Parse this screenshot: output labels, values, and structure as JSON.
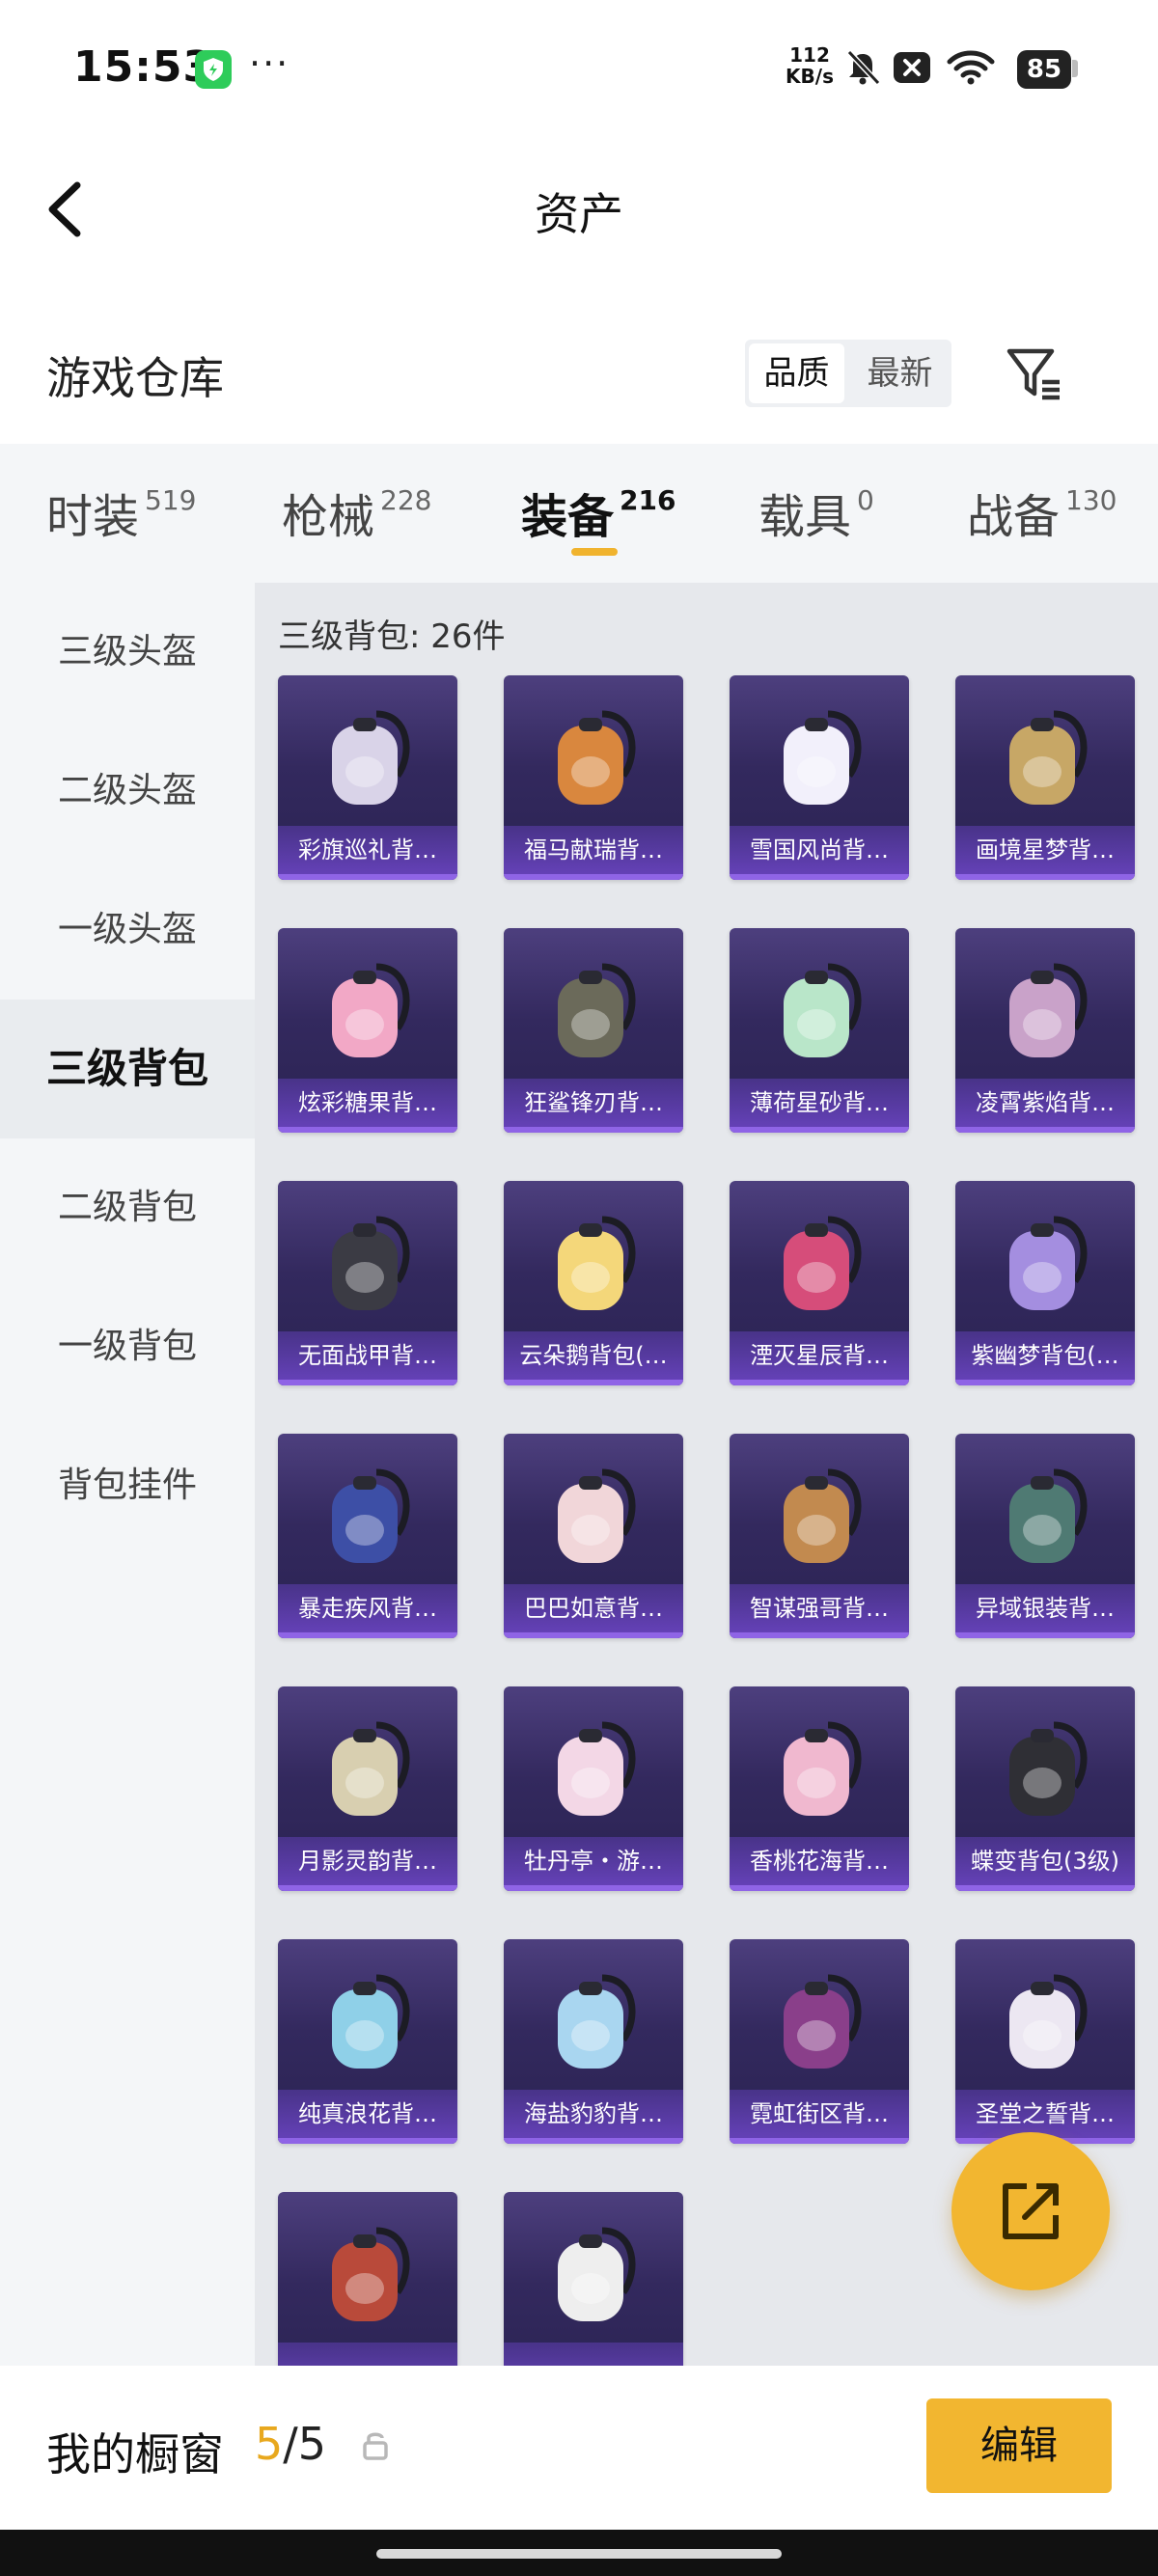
{
  "status_bar": {
    "time": "15:53",
    "speed_value": "112",
    "speed_unit": "KB/s",
    "battery": "85",
    "more": "···"
  },
  "header": {
    "title": "资产"
  },
  "section": {
    "title": "游戏仓库",
    "sort_options": [
      "品质",
      "最新"
    ],
    "active_sort": "品质"
  },
  "tabs": [
    {
      "label": "时装",
      "count": "519"
    },
    {
      "label": "枪械",
      "count": "228"
    },
    {
      "label": "装备",
      "count": "216"
    },
    {
      "label": "载具",
      "count": "0"
    },
    {
      "label": "战备",
      "count": "130"
    }
  ],
  "active_tab": "装备",
  "sidebar": {
    "items": [
      {
        "label": "三级头盔"
      },
      {
        "label": "二级头盔"
      },
      {
        "label": "一级头盔"
      },
      {
        "label": "三级背包"
      },
      {
        "label": "二级背包"
      },
      {
        "label": "一级背包"
      },
      {
        "label": "背包挂件"
      }
    ],
    "active": "三级背包"
  },
  "grid": {
    "title": "三级背包: 26件",
    "items": [
      {
        "label": "彩旗巡礼背…",
        "icon": "backpack-flag-icon",
        "color": "#d9d3e8"
      },
      {
        "label": "福马献瑞背…",
        "icon": "backpack-horse-icon",
        "color": "#d9873e"
      },
      {
        "label": "雪国风尚背…",
        "icon": "backpack-penguin-icon",
        "color": "#f2f0fb"
      },
      {
        "label": "画境星梦背…",
        "icon": "backpack-frame-icon",
        "color": "#c7a766"
      },
      {
        "label": "炫彩糖果背…",
        "icon": "backpack-donut-icon",
        "color": "#f2a8c6"
      },
      {
        "label": "狂鲨锋刃背…",
        "icon": "backpack-shark-icon",
        "color": "#6b6a5a"
      },
      {
        "label": "薄荷星砂背…",
        "icon": "backpack-mint-icon",
        "color": "#b9e6c9"
      },
      {
        "label": "凌霄紫焰背…",
        "icon": "backpack-flame-icon",
        "color": "#c9a2c9"
      },
      {
        "label": "无面战甲背…",
        "icon": "backpack-armor-icon",
        "color": "#3b3b44"
      },
      {
        "label": "云朵鹅背包(…",
        "icon": "backpack-goose-icon",
        "color": "#f4d77a"
      },
      {
        "label": "湮灭星辰背…",
        "icon": "backpack-star-icon",
        "color": "#d64d7a"
      },
      {
        "label": "紫幽梦背包(…",
        "icon": "backpack-dream-icon",
        "color": "#a48ee0"
      },
      {
        "label": "暴走疾风背…",
        "icon": "backpack-wind-icon",
        "color": "#3d4fa6"
      },
      {
        "label": "巴巴如意背…",
        "icon": "backpack-bunny-icon",
        "color": "#f1d6d9"
      },
      {
        "label": "智谋强哥背…",
        "icon": "backpack-dog-icon",
        "color": "#c28a4f"
      },
      {
        "label": "异域银装背…",
        "icon": "backpack-silver-icon",
        "color": "#4f7a73"
      },
      {
        "label": "月影灵韵背…",
        "icon": "backpack-moon-icon",
        "color": "#d8cfb0"
      },
      {
        "label": "牡丹亭・游…",
        "icon": "backpack-peony-icon",
        "color": "#f3d7e6"
      },
      {
        "label": "香桃花海背…",
        "icon": "backpack-peach-icon",
        "color": "#f0b8cf"
      },
      {
        "label": "蝶变背包(3级)",
        "icon": "backpack-butterfly-icon",
        "color": "#2f2f35"
      },
      {
        "label": "纯真浪花背…",
        "icon": "backpack-wave-icon",
        "color": "#8fd0e8"
      },
      {
        "label": "海盐豹豹背…",
        "icon": "backpack-seal-icon",
        "color": "#a9d6f0"
      },
      {
        "label": "霓虹街区背…",
        "icon": "backpack-neon-icon",
        "color": "#8a3f8a"
      },
      {
        "label": "圣堂之誓背…",
        "icon": "backpack-wings-icon",
        "color": "#ece7f2"
      },
      {
        "label": "",
        "icon": "backpack-cake-icon",
        "color": "#b94a3a"
      },
      {
        "label": "",
        "icon": "backpack-white-icon",
        "color": "#eeeeee"
      }
    ]
  },
  "bottom": {
    "window_label": "我的橱窗",
    "window_current": "5",
    "window_total": "/5",
    "edit_label": "编辑"
  }
}
